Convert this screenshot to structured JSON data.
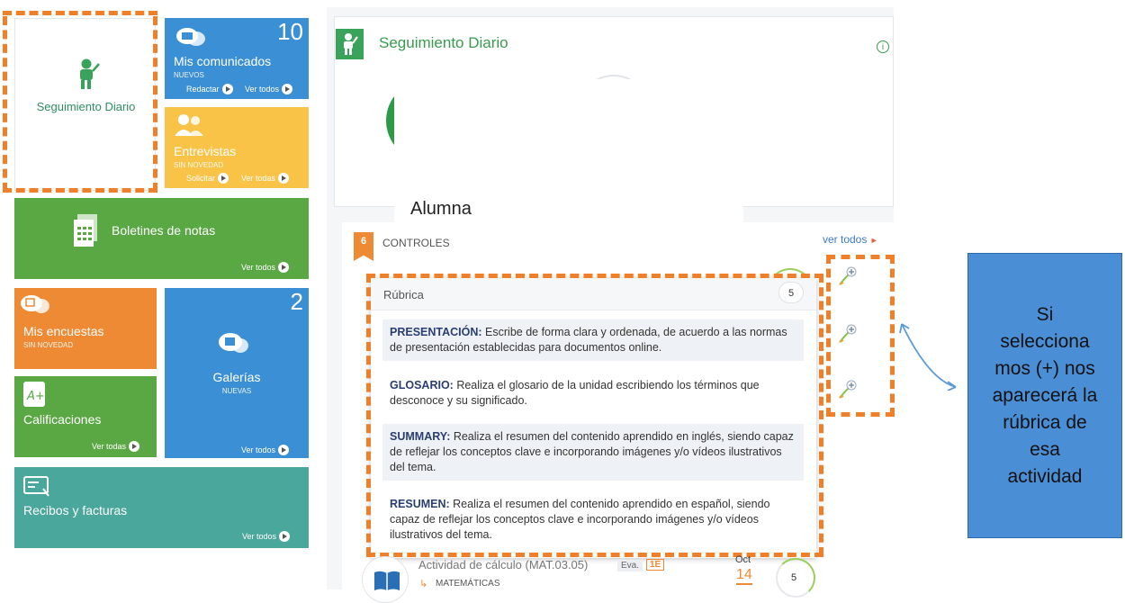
{
  "tiles": {
    "seguimiento": {
      "label": "Seguimiento Diario"
    },
    "comunicados": {
      "count": "10",
      "label": "Mis comunicados",
      "status": "NUEVOS",
      "action1": "Redactar",
      "action2": "Ver todos"
    },
    "entrevistas": {
      "label": "Entrevistas",
      "status": "SIN NOVEDAD",
      "action1": "Solicitar",
      "action2": "Ver todas"
    },
    "boletines": {
      "label": "Boletines de notas",
      "action": "Ver todos"
    },
    "encuestas": {
      "label": "Mis encuestas",
      "status": "SIN NOVEDAD"
    },
    "galerias": {
      "count": "2",
      "label": "Galerías",
      "status": "NUEVAS",
      "action": "Ver todos"
    },
    "calificaciones": {
      "label": "Calificaciones",
      "action": "Ver todas"
    },
    "recibos": {
      "label": "Recibos y facturas",
      "action": "Ver todos"
    }
  },
  "panel": {
    "title": "Seguimiento Diario",
    "student_label": "Alumna",
    "controls_count": "6",
    "controls_label": "CONTROLES",
    "see_all": "ver todos"
  },
  "rubric": {
    "title": "Rúbrica",
    "score": "5",
    "items": [
      {
        "term": "PRESENTACIÓN:",
        "text": " Escribe de forma clara y ordenada, de acuerdo a las normas de presentación establecidas para documentos online."
      },
      {
        "term": "GLOSARIO:",
        "text": " Realiza el glosario de la unidad escribiendo los términos que desconoce y su significado."
      },
      {
        "term": "SUMMARY:",
        "text": " Realiza el resumen del contenido aprendido en inglés, siendo capaz de reflejar los conceptos clave e incorporando imágenes y/o vídeos ilustrativos del tema."
      },
      {
        "term": "RESUMEN:",
        "text": " Realiza el resumen del contenido aprendido en español, siendo capaz de reflejar los conceptos clave e incorporando imágenes y/o vídeos ilustrativos del tema."
      }
    ]
  },
  "activity": {
    "title": "Actividad de cálculo (MAT.03.05)",
    "eval_label": "Eva.",
    "eval_value": "1E",
    "subject": "MATEMÁTICAS",
    "month": "Oct",
    "day": "14",
    "score": "5"
  },
  "callout": {
    "text": "Si selecciona mos (+) nos aparecerá la rúbrica de esa actividad"
  },
  "colors": {
    "blue": "#3b8fd4",
    "yellow": "#f9c347",
    "green": "#5aa844",
    "orange": "#ef8a34",
    "teal": "#4aa79b",
    "callout": "#4a8fd6",
    "dash": "#f07f2a"
  }
}
